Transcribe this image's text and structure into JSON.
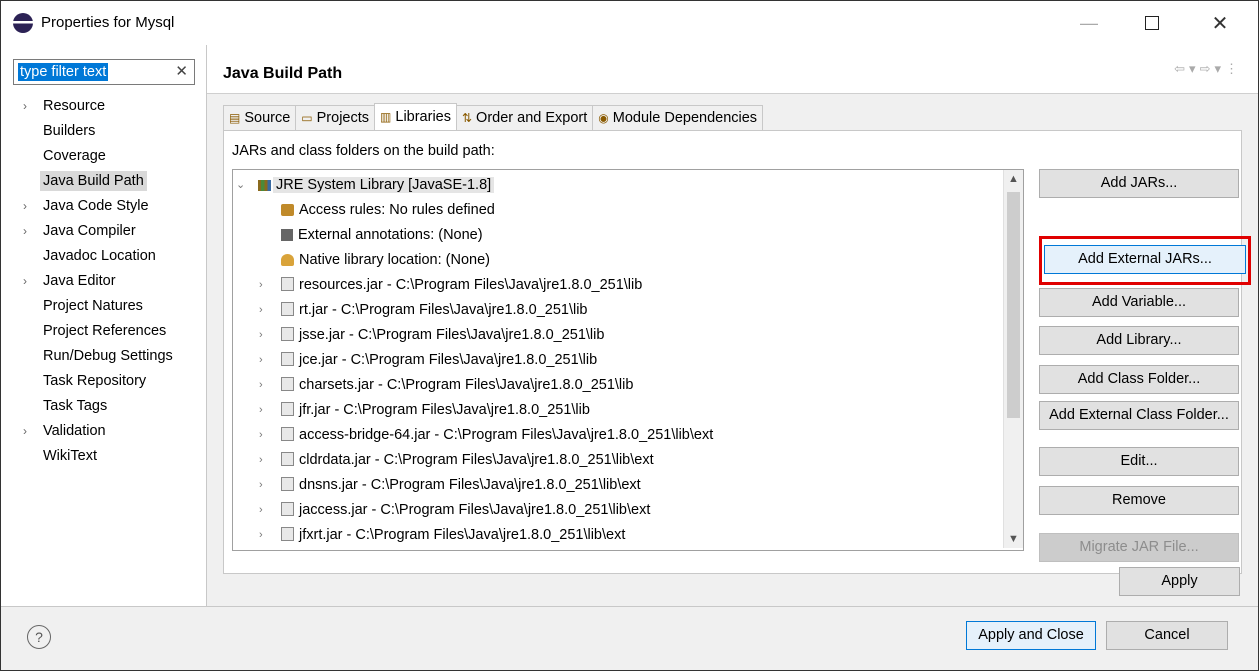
{
  "window": {
    "title": "Properties for Mysql",
    "close_glyph": "✕"
  },
  "filter": {
    "value": "type filter text",
    "clear_glyph": "✕"
  },
  "nav": {
    "items": [
      {
        "label": "Resource",
        "chevron": true
      },
      {
        "label": "Builders",
        "chevron": false
      },
      {
        "label": "Coverage",
        "chevron": false
      },
      {
        "label": "Java Build Path",
        "chevron": false,
        "selected": true
      },
      {
        "label": "Java Code Style",
        "chevron": true
      },
      {
        "label": "Java Compiler",
        "chevron": true
      },
      {
        "label": "Javadoc Location",
        "chevron": false
      },
      {
        "label": "Java Editor",
        "chevron": true
      },
      {
        "label": "Project Natures",
        "chevron": false
      },
      {
        "label": "Project References",
        "chevron": false
      },
      {
        "label": "Run/Debug Settings",
        "chevron": false
      },
      {
        "label": "Task Repository",
        "chevron": false
      },
      {
        "label": "Task Tags",
        "chevron": false
      },
      {
        "label": "Validation",
        "chevron": true
      },
      {
        "label": "WikiText",
        "chevron": false
      }
    ]
  },
  "page": {
    "title": "Java Build Path",
    "tabs": [
      {
        "label": "Source",
        "icon": "source-folder-icon"
      },
      {
        "label": "Projects",
        "icon": "projects-icon"
      },
      {
        "label": "Libraries",
        "icon": "libraries-icon",
        "active": true
      },
      {
        "label": "Order and Export",
        "icon": "order-export-icon"
      },
      {
        "label": "Module Dependencies",
        "icon": "module-icon"
      }
    ],
    "list_label": "JARs and class folders on the build path:"
  },
  "libraries": {
    "root": "JRE System Library [JavaSE-1.8]",
    "attributes": [
      {
        "label": "Access rules: No rules defined",
        "icon": "access-rules-icon"
      },
      {
        "label": "External annotations: (None)",
        "icon": "annotations-icon"
      },
      {
        "label": "Native library location: (None)",
        "icon": "native-library-icon"
      }
    ],
    "jars": [
      "resources.jar - C:\\Program Files\\Java\\jre1.8.0_251\\lib",
      "rt.jar - C:\\Program Files\\Java\\jre1.8.0_251\\lib",
      "jsse.jar - C:\\Program Files\\Java\\jre1.8.0_251\\lib",
      "jce.jar - C:\\Program Files\\Java\\jre1.8.0_251\\lib",
      "charsets.jar - C:\\Program Files\\Java\\jre1.8.0_251\\lib",
      "jfr.jar - C:\\Program Files\\Java\\jre1.8.0_251\\lib",
      "access-bridge-64.jar - C:\\Program Files\\Java\\jre1.8.0_251\\lib\\ext",
      "cldrdata.jar - C:\\Program Files\\Java\\jre1.8.0_251\\lib\\ext",
      "dnsns.jar - C:\\Program Files\\Java\\jre1.8.0_251\\lib\\ext",
      "jaccess.jar - C:\\Program Files\\Java\\jre1.8.0_251\\lib\\ext",
      "jfxrt.jar - C:\\Program Files\\Java\\jre1.8.0_251\\lib\\ext"
    ]
  },
  "buttons": {
    "add_jars": "Add JARs...",
    "add_external_jars": "Add External JARs...",
    "add_variable": "Add Variable...",
    "add_library": "Add Library...",
    "add_class_folder": "Add Class Folder...",
    "add_external_class_folder": "Add External Class Folder...",
    "edit": "Edit...",
    "remove": "Remove",
    "migrate_jar": "Migrate JAR File...",
    "apply": "Apply",
    "apply_and_close": "Apply and Close",
    "cancel": "Cancel"
  },
  "colors": {
    "highlight": "#e00000",
    "selection": "#0078d7"
  }
}
